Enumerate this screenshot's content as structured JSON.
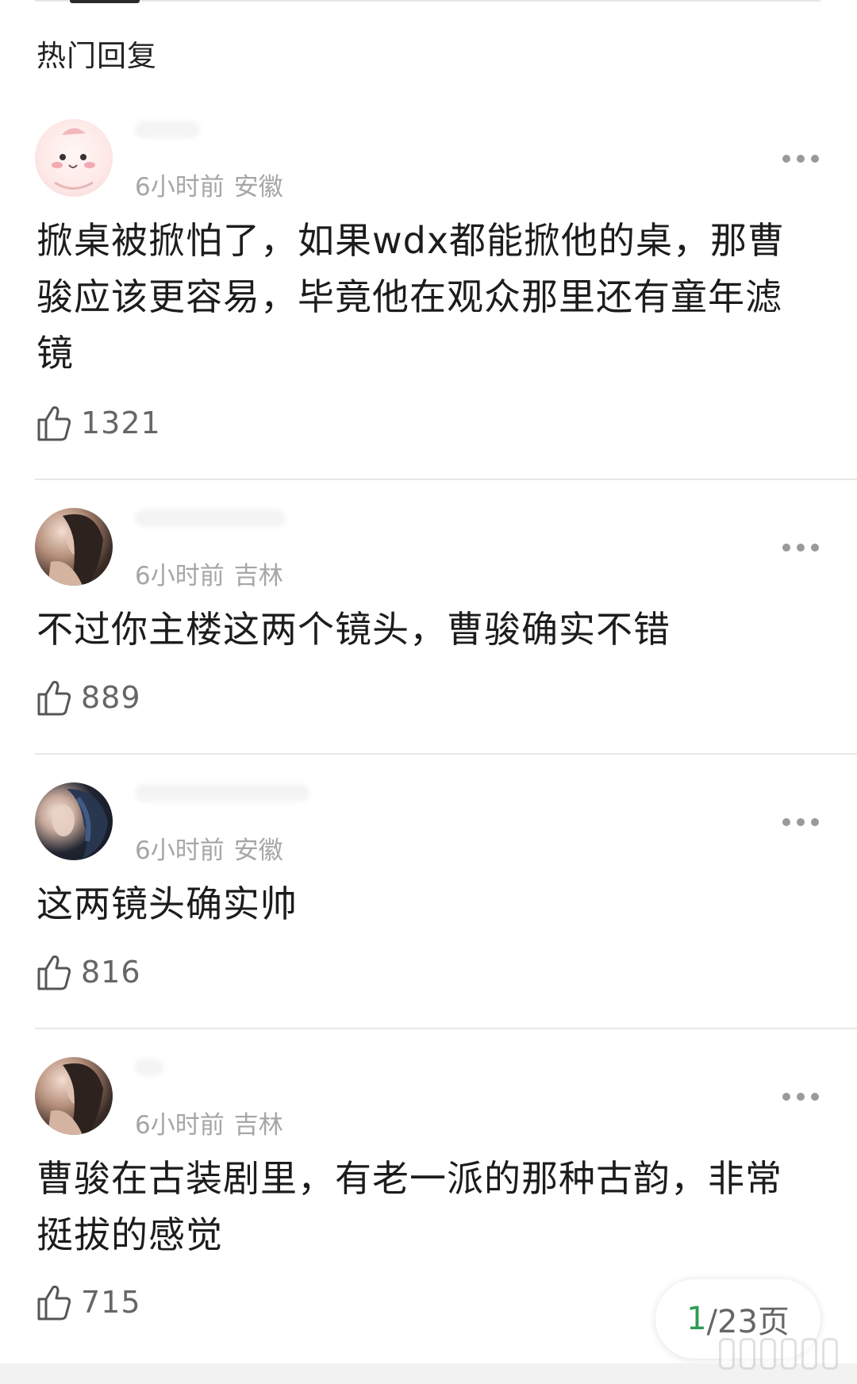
{
  "section_title": "热门回复",
  "comments": [
    {
      "time": "6小时前",
      "location": "安徽",
      "text": "掀桌被掀怕了，如果wdx都能掀他的桌，那曹骏应该更容易，毕竟他在观众那里还有童年滤镜",
      "likes": "1321"
    },
    {
      "time": "6小时前",
      "location": "吉林",
      "text": "不过你主楼这两个镜头，曹骏确实不错",
      "likes": "889"
    },
    {
      "time": "6小时前",
      "location": "安徽",
      "text": "这两镜头确实帅",
      "likes": "816"
    },
    {
      "time": "6小时前",
      "location": "吉林",
      "text": "曹骏在古装剧里，有老一派的那种古韵，非常挺拔的感觉",
      "likes": "715"
    }
  ],
  "pager": {
    "current": "1",
    "total": "/23页"
  },
  "icons": {
    "more": "more-dots-icon",
    "like": "thumbs-up-icon"
  },
  "colors": {
    "pager_current": "#2f9a55",
    "meta_text": "#a6a6a6"
  }
}
